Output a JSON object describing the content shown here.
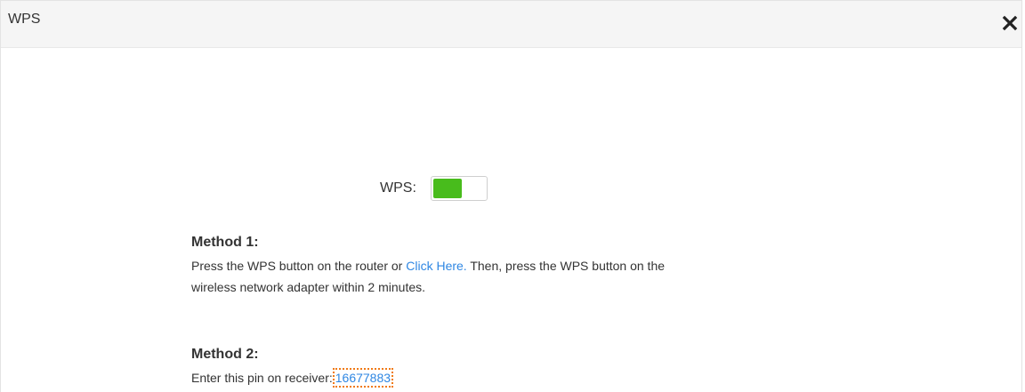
{
  "dialog": {
    "title": "WPS",
    "close_icon": "close-icon"
  },
  "wps": {
    "label": "WPS:",
    "enabled": true,
    "toggle_color": "#48bc1c"
  },
  "method1": {
    "title": "Method 1:",
    "text_before": "Press the WPS button on the router or ",
    "link": "Click Here.",
    "text_after_line1": " Then, press the WPS button on the",
    "text_line2": "wireless network adapter within 2 minutes."
  },
  "method2": {
    "title": "Method 2:",
    "text": "Enter this pin on receiver:",
    "pin": "16677883"
  },
  "colors": {
    "link": "#2f87e3",
    "highlight_border": "#f07a16"
  }
}
